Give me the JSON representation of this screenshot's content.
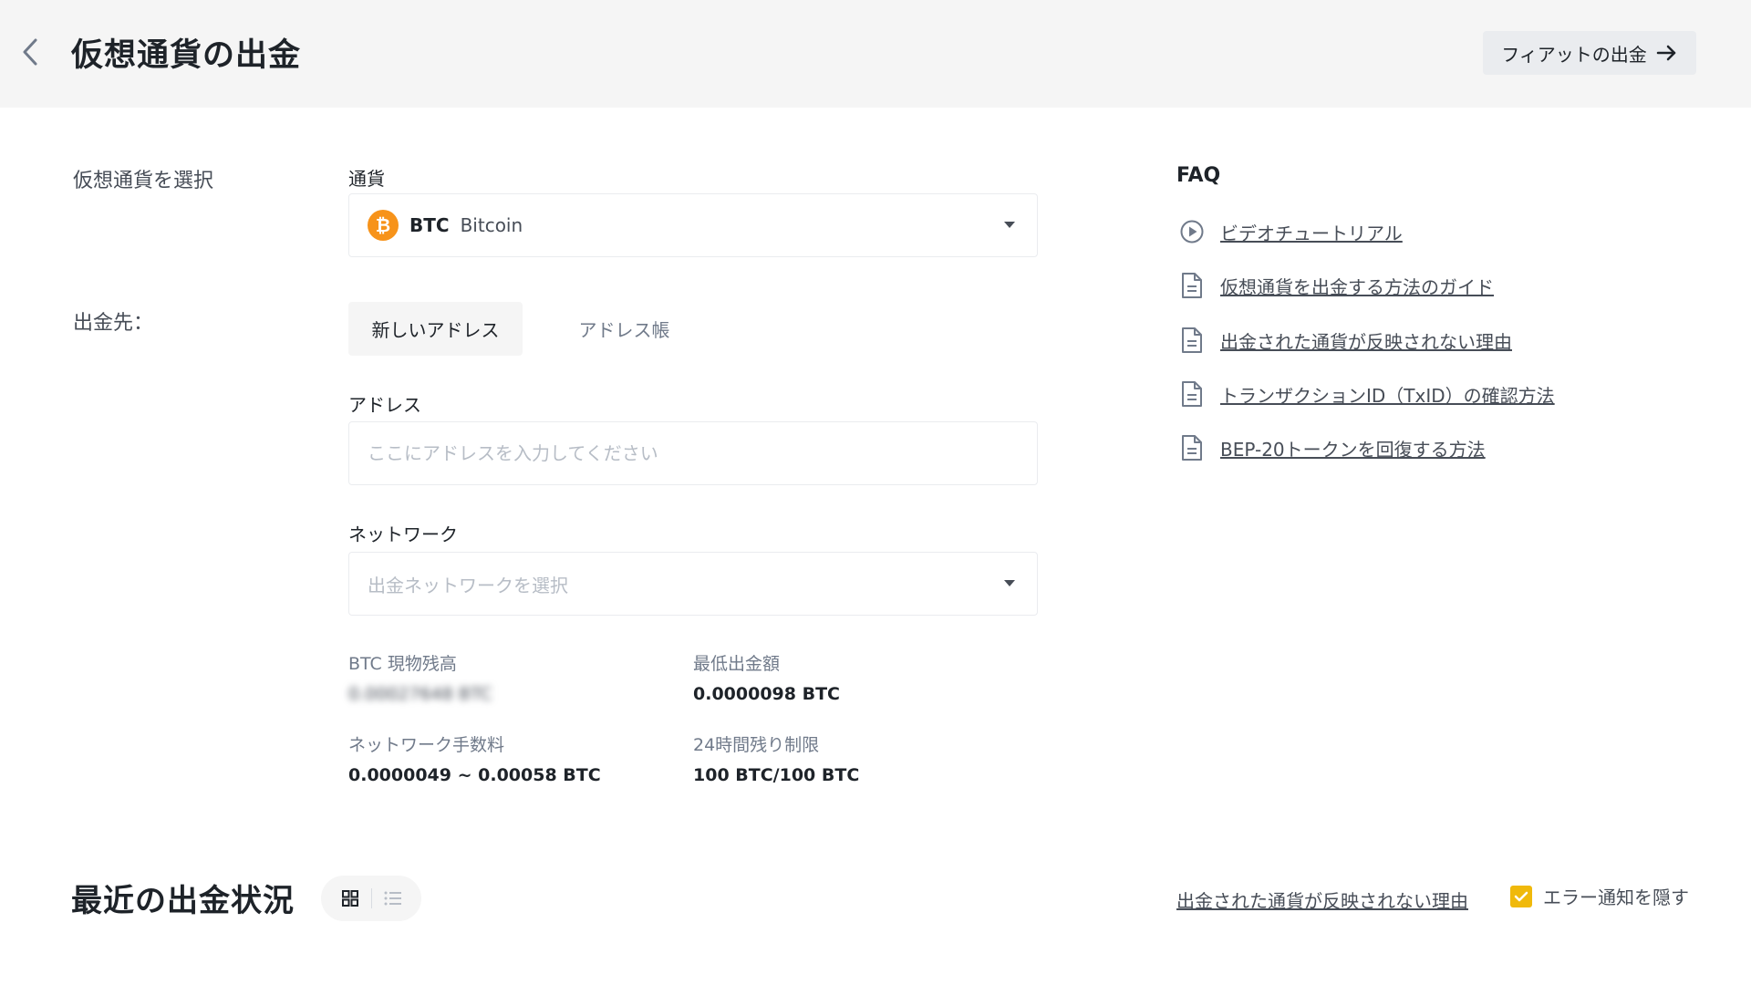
{
  "header": {
    "title": "仮想通貨の出金",
    "fiat_button_label": "フィアットの出金"
  },
  "form": {
    "select_crypto_label": "仮想通貨を選択",
    "currency_label": "通貨",
    "currency": {
      "code": "BTC",
      "name": "Bitcoin",
      "icon_symbol": "₿",
      "icon_color": "#f7931a"
    },
    "destination_label": "出金先：",
    "tabs": [
      {
        "label": "新しいアドレス",
        "active": true
      },
      {
        "label": "アドレス帳",
        "active": false
      }
    ],
    "address_label": "アドレス",
    "address_placeholder": "ここにアドレスを入力してください",
    "address_value": "",
    "network_label": "ネットワーク",
    "network_placeholder": "出金ネットワークを選択"
  },
  "info": {
    "balance_label": "BTC 現物残高",
    "balance_value": "0.00027648 BTC",
    "min_withdraw_label": "最低出金額",
    "min_withdraw_value": "0.0000098 BTC",
    "network_fee_label": "ネットワーク手数料",
    "network_fee_value": "0.0000049 ~ 0.00058 BTC",
    "daily_limit_label": "24時間残り制限",
    "daily_limit_value": "100 BTC/100 BTC"
  },
  "faq": {
    "title": "FAQ",
    "items": [
      {
        "label": "ビデオチュートリアル",
        "icon": "play-circle-icon"
      },
      {
        "label": "仮想通貨を出金する方法のガイド",
        "icon": "document-icon"
      },
      {
        "label": "出金された通貨が反映されない理由",
        "icon": "document-icon"
      },
      {
        "label": "トランザクションID（TxID）の確認方法",
        "icon": "document-icon"
      },
      {
        "label": "BEP-20トークンを回復する方法",
        "icon": "document-icon"
      }
    ]
  },
  "recent": {
    "title": "最近の出金状況",
    "reason_link": "出金された通貨が反映されない理由",
    "hide_errors_label": "エラー通知を隠す",
    "hide_errors_checked": true
  },
  "colors": {
    "accent": "#f0b90b",
    "header_bg": "#f5f5f5",
    "text_primary": "#1e2329",
    "text_secondary": "#707a8a"
  }
}
